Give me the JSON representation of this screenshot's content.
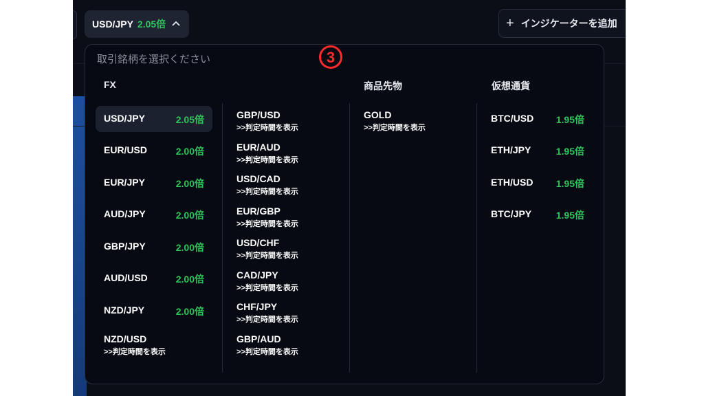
{
  "topbar": {
    "symbol": "USD/JPY",
    "symbol_multiplier": "2.05倍",
    "indicator_button": "インジケーターを追加"
  },
  "panel": {
    "search_placeholder": "取引銘柄を選択ください",
    "step_marker": "3",
    "categories": {
      "fx": "FX",
      "commodity": "商品先物",
      "crypto": "仮想通貨"
    },
    "fx_col1": [
      {
        "name": "USD/JPY",
        "rate": "2.05倍"
      },
      {
        "name": "EUR/USD",
        "rate": "2.00倍"
      },
      {
        "name": "EUR/JPY",
        "rate": "2.00倍"
      },
      {
        "name": "AUD/JPY",
        "rate": "2.00倍"
      },
      {
        "name": "GBP/JPY",
        "rate": "2.00倍"
      },
      {
        "name": "AUD/USD",
        "rate": "2.00倍"
      },
      {
        "name": "NZD/JPY",
        "rate": "2.00倍"
      }
    ],
    "fx_col1_last": {
      "name": "NZD/USD",
      "sub": ">>判定時間を表示"
    },
    "fx_col2": [
      {
        "name": "GBP/USD",
        "sub": ">>判定時間を表示"
      },
      {
        "name": "EUR/AUD",
        "sub": ">>判定時間を表示"
      },
      {
        "name": "USD/CAD",
        "sub": ">>判定時間を表示"
      },
      {
        "name": "EUR/GBP",
        "sub": ">>判定時間を表示"
      },
      {
        "name": "USD/CHF",
        "sub": ">>判定時間を表示"
      },
      {
        "name": "CAD/JPY",
        "sub": ">>判定時間を表示"
      },
      {
        "name": "CHF/JPY",
        "sub": ">>判定時間を表示"
      },
      {
        "name": "GBP/AUD",
        "sub": ">>判定時間を表示"
      }
    ],
    "commodity": [
      {
        "name": "GOLD",
        "sub": ">>判定時間を表示"
      }
    ],
    "crypto": [
      {
        "name": "BTC/USD",
        "rate": "1.95倍"
      },
      {
        "name": "ETH/JPY",
        "rate": "1.95倍"
      },
      {
        "name": "ETH/USD",
        "rate": "1.95倍"
      },
      {
        "name": "BTC/JPY",
        "rate": "1.95倍"
      }
    ]
  },
  "colors": {
    "accent_green": "#2ec45a",
    "step_marker_red": "#ff2a2a",
    "background": "#0b0e16"
  }
}
